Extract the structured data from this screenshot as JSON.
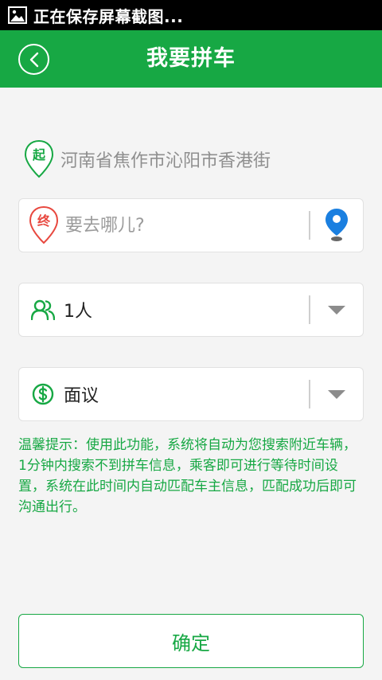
{
  "status_bar": {
    "text": "正在保存屏幕截图..."
  },
  "header": {
    "title": "我要拼车"
  },
  "start": {
    "badge": "起",
    "address": "河南省焦作市沁阳市香港街"
  },
  "destination": {
    "badge": "终",
    "placeholder": "要去哪儿?"
  },
  "passengers": {
    "value": "1人"
  },
  "price": {
    "value": "面议"
  },
  "tip": {
    "text": "温馨提示：使用此功能，系统将自动为您搜索附近车辆，1分钟内搜索不到拼车信息，乘客即可进行等待时间设置，系统在此时间内自动匹配车主信息，匹配成功后即可沟通出行。"
  },
  "confirm": {
    "label": "确定"
  },
  "colors": {
    "brand_green": "#17a844",
    "end_red": "#e8483f",
    "map_blue": "#1a7fe0"
  }
}
